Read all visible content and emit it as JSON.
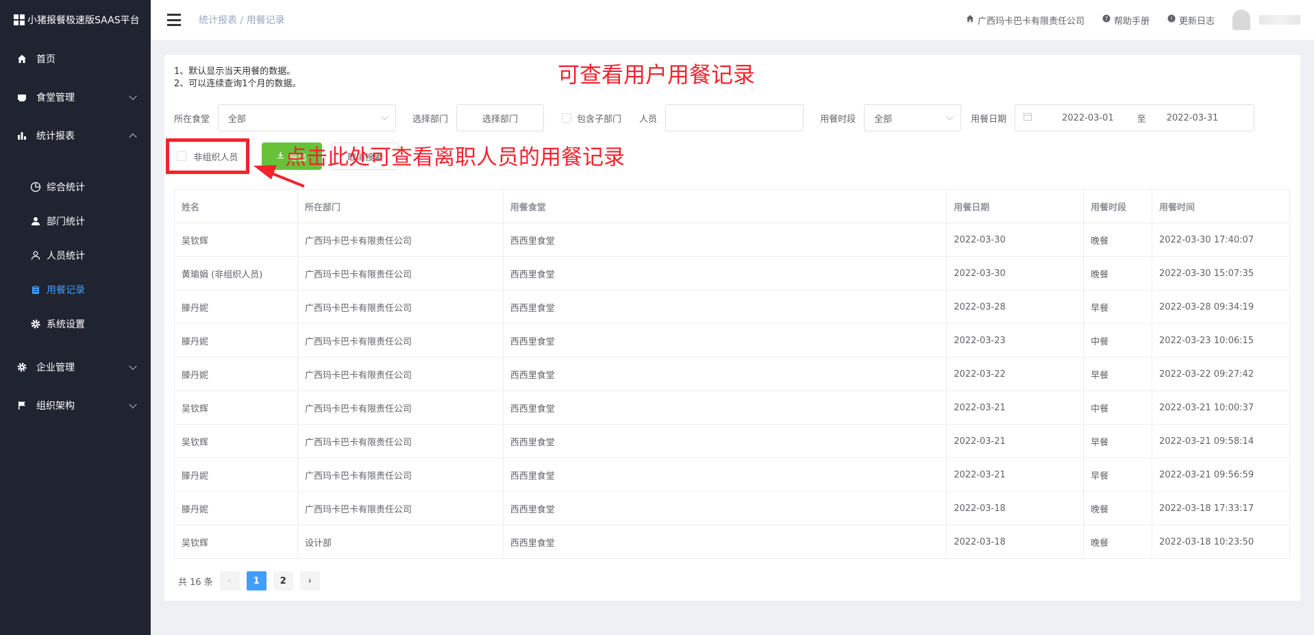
{
  "app": {
    "title": "小猪报餐极速版SAAS平台"
  },
  "sidebar": {
    "items": [
      {
        "label": "首页",
        "icon": "home-icon"
      },
      {
        "label": "食堂管理",
        "icon": "canteen-icon"
      },
      {
        "label": "统计报表",
        "icon": "bar-chart-icon"
      },
      {
        "label": "企业管理",
        "icon": "gear-icon"
      },
      {
        "label": "组织架构",
        "icon": "flag-icon"
      }
    ],
    "sub_items": [
      {
        "label": "综合统计",
        "icon": "pie-icon"
      },
      {
        "label": "部门统计",
        "icon": "user-icon"
      },
      {
        "label": "人员统计",
        "icon": "user-outline-icon"
      },
      {
        "label": "用餐记录",
        "icon": "clipboard-icon"
      },
      {
        "label": "系统设置",
        "icon": "gear-icon"
      }
    ],
    "active_color": "#409eff"
  },
  "header": {
    "breadcrumb": "统计报表 / 用餐记录",
    "company": "广西玛卡巴卡有限责任公司",
    "help": "帮助手册",
    "changelog": "更新日志"
  },
  "notes": {
    "line1": "1、默认显示当天用餐的数据。",
    "line2": "2、可以连续查询1个月的数据。"
  },
  "annotations": {
    "top": "可查看用户用餐记录",
    "arrow": "点击此处可查看离职人员的用餐记录"
  },
  "filters": {
    "canteen_label": "所在食堂",
    "canteen_value": "全部",
    "dept_label": "选择部门",
    "dept_button": "选择部门",
    "include_sub_label": "包含子部门",
    "person_label": "人员",
    "period_label": "用餐时段",
    "period_value": "全部",
    "date_label": "用餐日期",
    "date_start": "2022-03-01",
    "date_sep": "至",
    "date_end": "2022-03-31"
  },
  "actions": {
    "non_org_label": "非组织人员",
    "export_label": "导出",
    "cancel_label": "取消搜索"
  },
  "table": {
    "headers": [
      "姓名",
      "所在部门",
      "用餐食堂",
      "用餐日期",
      "用餐时段",
      "用餐时间"
    ],
    "rows": [
      [
        "吴钦辉",
        "广西玛卡巴卡有限责任公司",
        "西西里食堂",
        "2022-03-30",
        "晚餐",
        "2022-03-30 17:40:07"
      ],
      [
        "黄瑜娟 (非组织人员)",
        "广西玛卡巴卡有限责任公司",
        "西西里食堂",
        "2022-03-30",
        "晚餐",
        "2022-03-30 15:07:35"
      ],
      [
        "滕丹妮",
        "广西玛卡巴卡有限责任公司",
        "西西里食堂",
        "2022-03-28",
        "早餐",
        "2022-03-28 09:34:19"
      ],
      [
        "滕丹妮",
        "广西玛卡巴卡有限责任公司",
        "西西里食堂",
        "2022-03-23",
        "中餐",
        "2022-03-23 10:06:15"
      ],
      [
        "滕丹妮",
        "广西玛卡巴卡有限责任公司",
        "西西里食堂",
        "2022-03-22",
        "早餐",
        "2022-03-22 09:27:42"
      ],
      [
        "吴钦辉",
        "广西玛卡巴卡有限责任公司",
        "西西里食堂",
        "2022-03-21",
        "中餐",
        "2022-03-21 10:00:37"
      ],
      [
        "吴钦辉",
        "广西玛卡巴卡有限责任公司",
        "西西里食堂",
        "2022-03-21",
        "早餐",
        "2022-03-21 09:58:14"
      ],
      [
        "滕丹妮",
        "广西玛卡巴卡有限责任公司",
        "西西里食堂",
        "2022-03-21",
        "早餐",
        "2022-03-21 09:56:59"
      ],
      [
        "滕丹妮",
        "广西玛卡巴卡有限责任公司",
        "西西里食堂",
        "2022-03-18",
        "晚餐",
        "2022-03-18 17:33:17"
      ],
      [
        "吴钦辉",
        "设计部",
        "西西里食堂",
        "2022-03-18",
        "晚餐",
        "2022-03-18 10:23:50"
      ]
    ]
  },
  "pagination": {
    "total_text": "共 16 条",
    "pages": [
      "1",
      "2"
    ],
    "current": "1"
  },
  "colors": {
    "export_green": "#67c23a",
    "highlight_red": "#f5222d",
    "primary_blue": "#409eff"
  }
}
